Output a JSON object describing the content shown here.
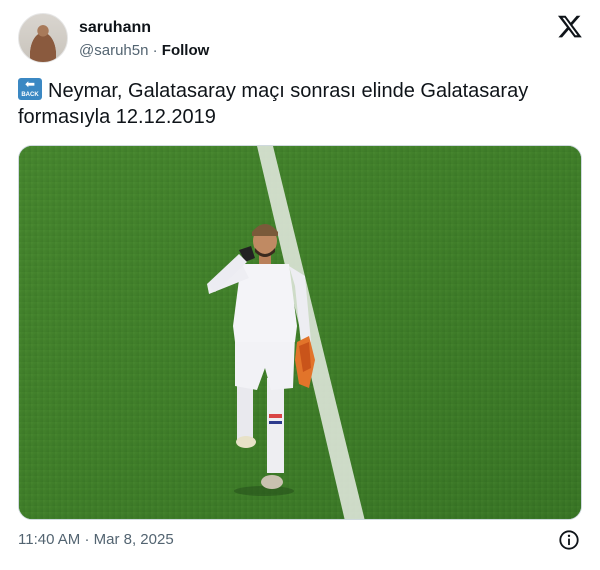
{
  "author": {
    "name": "saruhann",
    "handle": "@saruh5n",
    "separator": "·",
    "follow_label": "Follow"
  },
  "tweet": {
    "emoji_label": "BACK",
    "text": "Neymar, Galatasaray maçı sonrası elinde Galatasaray formasıyla 12.12.2019"
  },
  "meta": {
    "time": "11:40 AM",
    "date": "Mar 8, 2025",
    "separator": "·"
  },
  "icons": {
    "brand": "x-logo-icon",
    "info": "info-icon",
    "emoji": "back-arrow-emoji-icon"
  },
  "colors": {
    "text": "#0f1419",
    "secondary": "#536471",
    "pitch": "#3f7a2a",
    "emoji_blue": "#3b88c3"
  }
}
